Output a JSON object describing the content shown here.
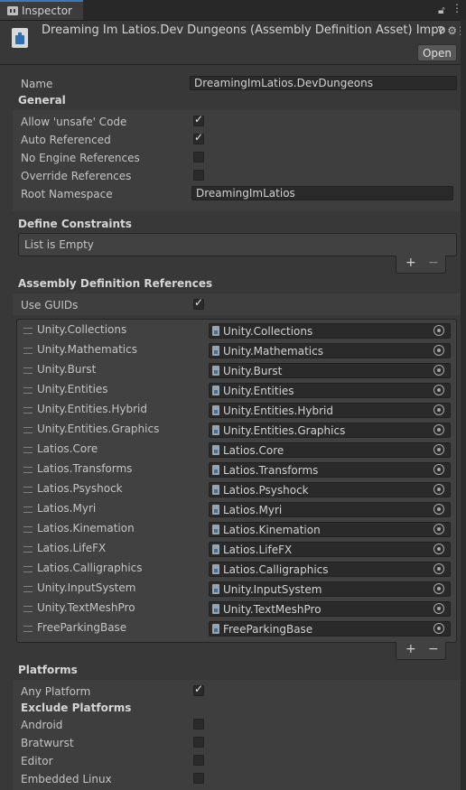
{
  "tab": {
    "label": "Inspector"
  },
  "header": {
    "title": "Dreaming Im Latios.Dev Dungeons (Assembly Definition Asset) Impo",
    "open_label": "Open"
  },
  "fields": {
    "name_label": "Name",
    "name_value": "DreamingImLatios.DevDungeons"
  },
  "general": {
    "title": "General",
    "allow_unsafe": {
      "label": "Allow 'unsafe' Code",
      "checked": true
    },
    "auto_referenced": {
      "label": "Auto Referenced",
      "checked": true
    },
    "no_engine_refs": {
      "label": "No Engine References",
      "checked": false
    },
    "override_refs": {
      "label": "Override References",
      "checked": false
    },
    "root_namespace": {
      "label": "Root Namespace",
      "value": "DreamingImLatios"
    }
  },
  "define_constraints": {
    "title": "Define Constraints",
    "empty_text": "List is Empty"
  },
  "assembly_refs": {
    "title": "Assembly Definition References",
    "use_guids_label": "Use GUIDs",
    "use_guids_checked": true,
    "items": [
      {
        "label": "Unity.Collections",
        "value": "Unity.Collections"
      },
      {
        "label": "Unity.Mathematics",
        "value": "Unity.Mathematics"
      },
      {
        "label": "Unity.Burst",
        "value": "Unity.Burst"
      },
      {
        "label": "Unity.Entities",
        "value": "Unity.Entities"
      },
      {
        "label": "Unity.Entities.Hybrid",
        "value": "Unity.Entities.Hybrid"
      },
      {
        "label": "Unity.Entities.Graphics",
        "value": "Unity.Entities.Graphics"
      },
      {
        "label": "Latios.Core",
        "value": "Latios.Core"
      },
      {
        "label": "Latios.Transforms",
        "value": "Latios.Transforms"
      },
      {
        "label": "Latios.Psyshock",
        "value": "Latios.Psyshock"
      },
      {
        "label": "Latios.Myri",
        "value": "Latios.Myri"
      },
      {
        "label": "Latios.Kinemation",
        "value": "Latios.Kinemation"
      },
      {
        "label": "Latios.LifeFX",
        "value": "Latios.LifeFX"
      },
      {
        "label": "Latios.Calligraphics",
        "value": "Latios.Calligraphics"
      },
      {
        "label": "Unity.InputSystem",
        "value": "Unity.InputSystem"
      },
      {
        "label": "Unity.TextMeshPro",
        "value": "Unity.TextMeshPro"
      },
      {
        "label": "FreeParkingBase",
        "value": "FreeParkingBase"
      }
    ]
  },
  "list_controls": {
    "plus": "+",
    "minus": "−"
  },
  "platforms": {
    "title": "Platforms",
    "any_platform": {
      "label": "Any Platform",
      "checked": true
    },
    "exclude_title": "Exclude Platforms",
    "excluded": [
      {
        "label": "Android",
        "checked": false
      },
      {
        "label": "Bratwurst",
        "checked": false
      },
      {
        "label": "Editor",
        "checked": false
      },
      {
        "label": "Embedded Linux",
        "checked": false
      }
    ]
  },
  "icons": [
    "inspector-tab-icon",
    "lock-icon",
    "menu-icon",
    "asset-icon",
    "help-icon",
    "settings-icon",
    "drag-handle-icon",
    "file-icon",
    "object-picker-icon"
  ]
}
